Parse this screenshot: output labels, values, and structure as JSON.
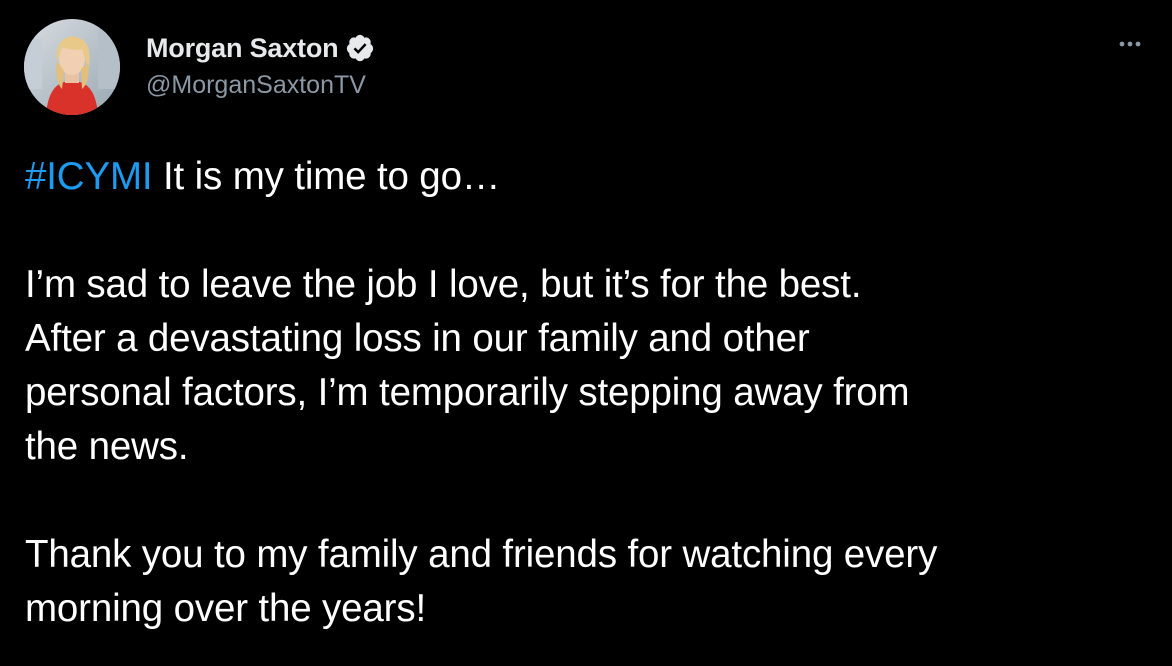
{
  "author": {
    "display_name": "Morgan Saxton",
    "handle": "@MorganSaxtonTV",
    "verified": true,
    "avatar_icon": "profile-photo"
  },
  "header": {
    "more_icon": "more-horizontal-icon"
  },
  "tweet": {
    "hashtag": "#ICYMI",
    "line1_rest": " It is my time to go…",
    "paragraph2": [
      "I’m sad to leave the job I love, but it’s for the best.",
      "After a devastating loss in our family and other",
      "personal factors, I’m temporarily stepping away from",
      "the news."
    ],
    "paragraph3": [
      "Thank you to my family and friends for watching every",
      "morning over the years!"
    ]
  },
  "colors": {
    "background": "#000000",
    "text": "#ffffff",
    "secondary_text": "#8b98a5",
    "link": "#1d9bf0",
    "verified_badge": "#e7e9ea"
  }
}
